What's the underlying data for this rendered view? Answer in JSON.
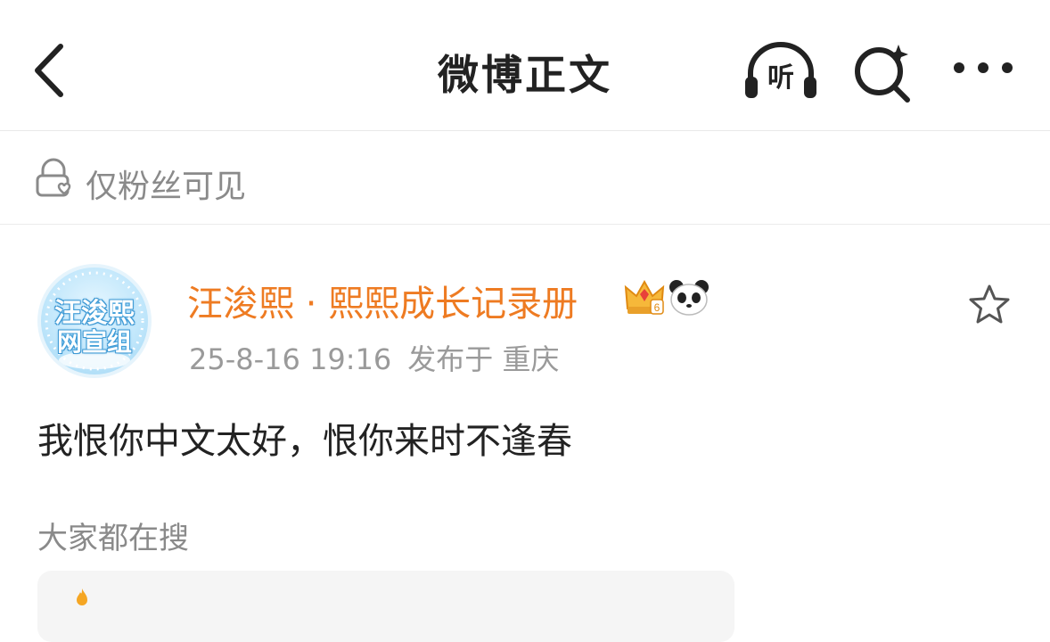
{
  "header": {
    "title": "微博正文",
    "listen_label": "听"
  },
  "visibility": {
    "label": "仅粉丝可见"
  },
  "post": {
    "avatar_text_line1": "汪浚熙",
    "avatar_text_line2": "网宣组",
    "username": "汪浚熙 · 熙熙成长记录册",
    "crown_level": "6",
    "date": "25-8-16 19:16",
    "published_at": "发布于 重庆",
    "content": "我恨你中文太好，恨你来时不逢春"
  },
  "search": {
    "heading": "大家都在搜"
  },
  "colors": {
    "username": "#ee7b22",
    "muted_text": "#8a8a8a",
    "divider": "#e9e9e9"
  }
}
